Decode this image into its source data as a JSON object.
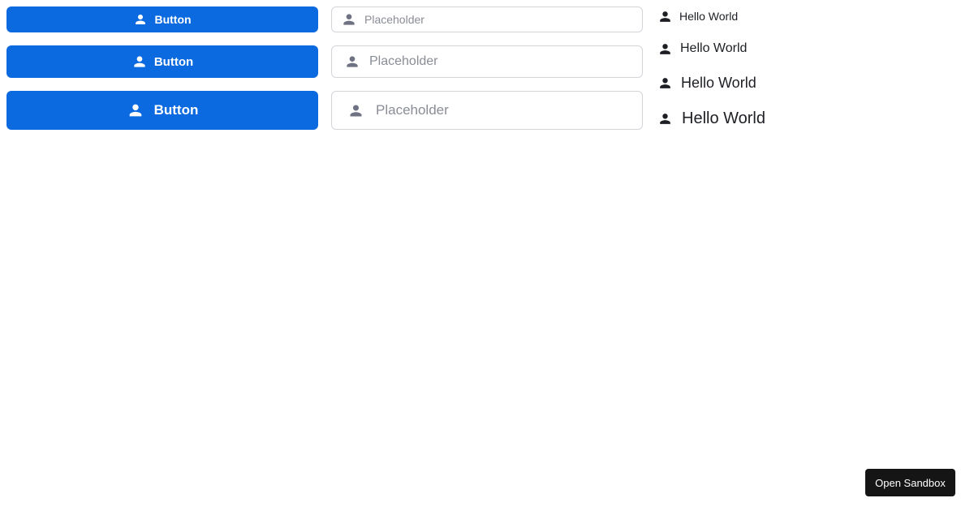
{
  "buttons": [
    {
      "label": "Button",
      "icon": "user-icon"
    },
    {
      "label": "Button",
      "icon": "user-icon"
    },
    {
      "label": "Button",
      "icon": "user-icon"
    }
  ],
  "inputs": [
    {
      "value": "",
      "placeholder": "Placeholder",
      "icon": "user-icon"
    },
    {
      "value": "",
      "placeholder": "Placeholder",
      "icon": "user-icon"
    },
    {
      "value": "",
      "placeholder": "Placeholder",
      "icon": "user-icon"
    }
  ],
  "texts": [
    {
      "text": "Hello World",
      "icon": "user-icon"
    },
    {
      "text": "Hello World",
      "icon": "user-icon"
    },
    {
      "text": "Hello World",
      "icon": "user-icon"
    },
    {
      "text": "Hello World",
      "icon": "user-icon"
    }
  ],
  "sandbox": {
    "label": "Open Sandbox"
  },
  "colors": {
    "primary": "#0b6adf",
    "text": "#1d1f24",
    "icon_muted": "#6f7283",
    "border": "#d3d4d8",
    "sandbox_bg": "#151515"
  }
}
